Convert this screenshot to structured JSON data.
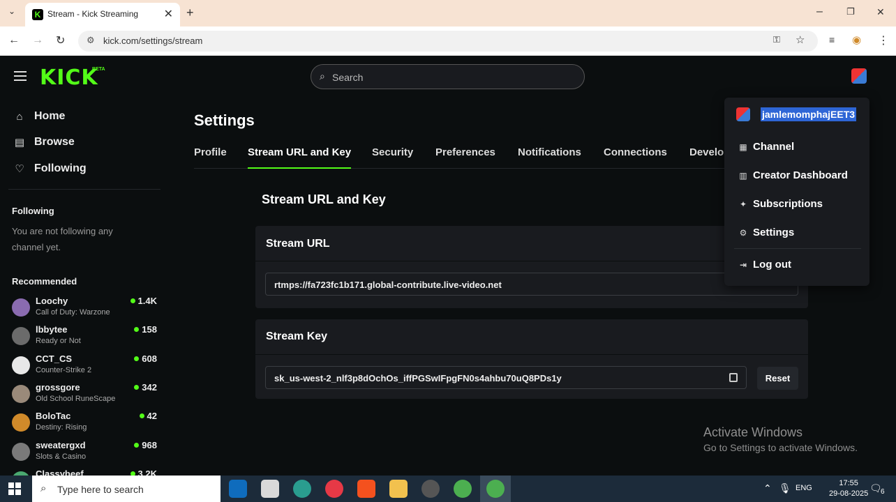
{
  "browser": {
    "tab_title": "Stream - Kick Streaming",
    "url": "kick.com/settings/stream",
    "new_tab": "+",
    "close_tab": "✕"
  },
  "header": {
    "logo": "KICK",
    "logo_badge": "BETA",
    "search_placeholder": "Search"
  },
  "sidebar": {
    "nav": [
      {
        "label": "Home",
        "icon": "home-icon"
      },
      {
        "label": "Browse",
        "icon": "browse-icon"
      },
      {
        "label": "Following",
        "icon": "heart-icon"
      }
    ],
    "following_heading": "Following",
    "following_empty": "You are not following any channel yet.",
    "recommended_heading": "Recommended",
    "recommended": [
      {
        "name": "Loochy",
        "category": "Call of Duty: Warzone",
        "viewers": "1.4K",
        "color": "#8a6bb0"
      },
      {
        "name": "lbbytee",
        "category": "Ready or Not",
        "viewers": "158",
        "color": "#6b6b6b"
      },
      {
        "name": "CCT_CS",
        "category": "Counter-Strike 2",
        "viewers": "608",
        "color": "#e8e8e8"
      },
      {
        "name": "grossgore",
        "category": "Old School RuneScape",
        "viewers": "342",
        "color": "#9a8a7a"
      },
      {
        "name": "BoloTac",
        "category": "Destiny: Rising",
        "viewers": "42",
        "color": "#d08a2a"
      },
      {
        "name": "sweatergxd",
        "category": "Slots & Casino",
        "viewers": "968",
        "color": "#7a7a7a"
      },
      {
        "name": "Classybeef",
        "category": "",
        "viewers": "3.2K",
        "color": "#4aa870"
      }
    ]
  },
  "main": {
    "title": "Settings",
    "tabs": [
      "Profile",
      "Stream URL and Key",
      "Security",
      "Preferences",
      "Notifications",
      "Connections",
      "Develo"
    ],
    "active_tab": "Stream URL and Key",
    "section_title": "Stream URL and Key",
    "stream_url_label": "Stream URL",
    "stream_url_value": "rtmps://fa723fc1b171.global-contribute.live-video.net",
    "stream_key_label": "Stream Key",
    "stream_key_value": "sk_us-west-2_nlf3p8dOchOs_iffPGSwIFpgFN0s4ahbu70uQ8PDs1y",
    "reset_label": "Reset"
  },
  "user_menu": {
    "username": "jamlemomphajEET3",
    "items": [
      {
        "label": "Channel",
        "icon": "channel-icon"
      },
      {
        "label": "Creator Dashboard",
        "icon": "dashboard-icon"
      },
      {
        "label": "Subscriptions",
        "icon": "sparkle-icon"
      },
      {
        "label": "Settings",
        "icon": "gear-icon"
      }
    ],
    "logout_label": "Log out"
  },
  "watermark": {
    "line1": "Activate Windows",
    "line2": "Go to Settings to activate Windows."
  },
  "taskbar": {
    "search_placeholder": "Type here to search",
    "language": "ENG",
    "time": "17:55",
    "date": "29-08-2025",
    "notification_count": "6"
  },
  "colors": {
    "accent": "#53fc18",
    "background": "#0b0e0f",
    "card": "#191b1f",
    "selection": "#2e66d6"
  }
}
